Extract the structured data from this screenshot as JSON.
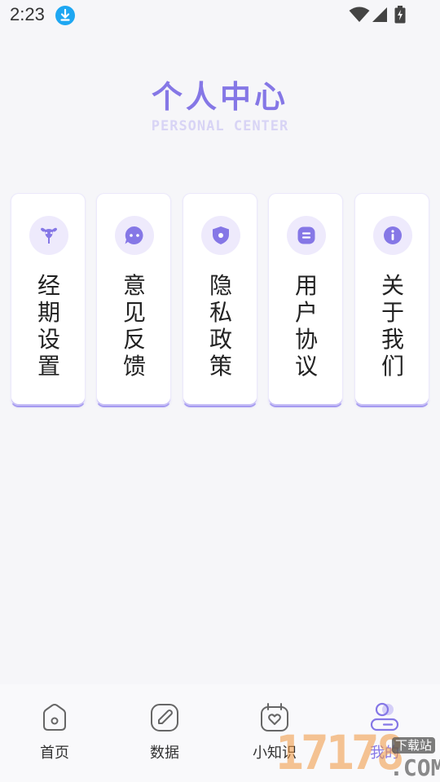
{
  "status_bar": {
    "time": "2:23",
    "icons": [
      "download-icon",
      "wifi-icon",
      "signal-icon",
      "battery-icon"
    ]
  },
  "header": {
    "title": "个人中心",
    "subtitle": "PERSONAL CENTER"
  },
  "cards": [
    {
      "icon": "uterus-icon",
      "chars": [
        "经",
        "期",
        "设",
        "置"
      ]
    },
    {
      "icon": "chat-bubble-icon",
      "chars": [
        "意",
        "见",
        "反",
        "馈"
      ]
    },
    {
      "icon": "shield-icon",
      "chars": [
        "隐",
        "私",
        "政",
        "策"
      ]
    },
    {
      "icon": "document-icon",
      "chars": [
        "用",
        "户",
        "协",
        "议"
      ]
    },
    {
      "icon": "info-icon",
      "chars": [
        "关",
        "于",
        "我",
        "们"
      ]
    }
  ],
  "bottom_nav": [
    {
      "label": "首页",
      "icon": "home-icon",
      "active": false
    },
    {
      "label": "数据",
      "icon": "pen-icon",
      "active": false
    },
    {
      "label": "小知识",
      "icon": "calendar-heart-icon",
      "active": false
    },
    {
      "label": "我的",
      "icon": "profile-icon",
      "active": true
    }
  ],
  "watermark": {
    "number": "17178",
    "domain": ".COM",
    "tag": "下载站"
  },
  "colors": {
    "accent": "#8577e6",
    "accent_light": "#eeeafc",
    "subtitle": "#d8d4f5",
    "background": "#f6f6f9"
  }
}
